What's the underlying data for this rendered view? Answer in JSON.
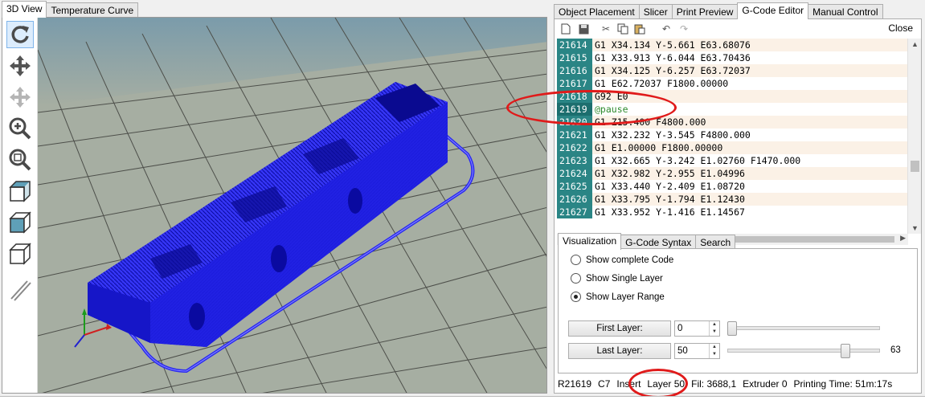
{
  "left_tabs": [
    {
      "label": "3D View",
      "active": true
    },
    {
      "label": "Temperature Curve",
      "active": false
    }
  ],
  "right_tabs": [
    {
      "label": "Object Placement",
      "active": false
    },
    {
      "label": "Slicer",
      "active": false
    },
    {
      "label": "Print Preview",
      "active": false
    },
    {
      "label": "G-Code Editor",
      "active": true
    },
    {
      "label": "Manual Control",
      "active": false
    }
  ],
  "toolbar_icons": [
    "rotate-view-icon",
    "move-view-icon",
    "move-object-icon",
    "zoom-icon",
    "zoom-fit-icon",
    "front-view-icon",
    "side-view-icon",
    "top-view-icon",
    "parallel-projection-icon"
  ],
  "editor": {
    "toolbar_icons": [
      "new-file-icon",
      "save-icon",
      "cut-icon",
      "copy-icon",
      "paste-icon",
      "undo-icon",
      "redo-icon"
    ],
    "close_label": "Close",
    "lines": [
      {
        "num": "21614",
        "text": "G1 X34.134 Y-5.661 E63.68076"
      },
      {
        "num": "21615",
        "text": "G1 X33.913 Y-6.044 E63.70436"
      },
      {
        "num": "21616",
        "text": "G1 X34.125 Y-6.257 E63.72037"
      },
      {
        "num": "21617",
        "text": "G1 E62.72037 F1800.00000"
      },
      {
        "num": "21618",
        "text": "G92 E0"
      },
      {
        "num": "21619",
        "text": "@pause"
      },
      {
        "num": "21620",
        "text": "G1 Z15.400 F4800.000"
      },
      {
        "num": "21621",
        "text": "G1 X32.232 Y-3.545 F4800.000"
      },
      {
        "num": "21622",
        "text": "G1 E1.00000 F1800.00000"
      },
      {
        "num": "21623",
        "text": "G1 X32.665 Y-3.242 E1.02760 F1470.000"
      },
      {
        "num": "21624",
        "text": "G1 X32.982 Y-2.955 E1.04996"
      },
      {
        "num": "21625",
        "text": "G1 X33.440 Y-2.409 E1.08720"
      },
      {
        "num": "21626",
        "text": "G1 X33.795 Y-1.794 E1.12430"
      },
      {
        "num": "21627",
        "text": "G1 X33.952 Y-1.416 E1.14567"
      }
    ]
  },
  "sub_tabs": [
    {
      "label": "Visualization",
      "active": true
    },
    {
      "label": "G-Code Syntax",
      "active": false
    },
    {
      "label": "Search",
      "active": false
    }
  ],
  "visualization": {
    "options": [
      {
        "label": "Show complete Code",
        "checked": false
      },
      {
        "label": "Show Single Layer",
        "checked": false
      },
      {
        "label": "Show Layer Range",
        "checked": true
      }
    ],
    "first_layer": {
      "label": "First Layer:",
      "value": "0",
      "slider_fraction": 0.0
    },
    "last_layer": {
      "label": "Last Layer:",
      "value": "50",
      "slider_fraction": 0.79,
      "max_label": "63"
    }
  },
  "status": {
    "row": "R21619",
    "col": "C7",
    "mode": "Insert",
    "layer": "Layer 50",
    "fil": "Fil: 3688,1",
    "extruder": "Extruder 0",
    "time": "Printing Time: 51m:17s"
  },
  "colors": {
    "model": "#2222ee",
    "line_number_bg": "#2a8585",
    "scene_top": "#5e8fb0",
    "scene_floor": "#a6aea2",
    "highlight_ellipse": "#e01a1a"
  }
}
